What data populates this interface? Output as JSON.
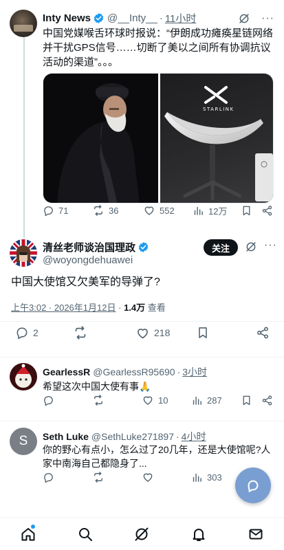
{
  "parent_tweet": {
    "author_name": "Inty News",
    "handle": "@__Inty__",
    "separator": "·",
    "time": "11小时",
    "text": "中国党媒喉舌环球时报说：“伊朗成功瘫痪星链网络并干扰GPS信号……切断了美以之间所有协调抗议活动的渠道”。。。",
    "image_right_logo_text": "STARLINK",
    "stats": {
      "replies": "71",
      "retweets": "36",
      "likes": "552",
      "views": "12万"
    }
  },
  "main_tweet": {
    "author_name": "清丝老师谈治国理政",
    "handle": "@woyongdehuawei",
    "follow_label": "关注",
    "text": "中国大使馆又欠美军的导弹了?",
    "timestamp": "上午3:02 · 2026年1月12日",
    "meta_separator": "·",
    "views_count": "1.4万",
    "views_label": "查看",
    "stats": {
      "replies": "2",
      "likes": "218"
    }
  },
  "replies": [
    {
      "author_name": "GearlessR",
      "handle": "@GearlessR95690",
      "separator": "·",
      "time": "3小时",
      "text": "希望这次中国大使有事🙏",
      "stats": {
        "likes": "10",
        "views": "287"
      }
    },
    {
      "author_name": "Seth Luke",
      "handle": "@SethLuke271897",
      "separator": "·",
      "time": "4小时",
      "avatar_letter": "S",
      "text": "你的野心有点小，怎么过了20几年，还是大使馆呢?人家中南海自己都隐身了...",
      "stats": {
        "views": "303"
      }
    }
  ],
  "more_glyph": "···",
  "colors": {
    "verified": "#1d9bf0",
    "text": "#0f1419",
    "muted": "#536471",
    "fab": "#6e96cd"
  },
  "icons": [
    "verified-badge-icon",
    "grok-icon",
    "reply-icon",
    "retweet-icon",
    "like-icon",
    "views-icon",
    "bookmark-icon",
    "share-icon",
    "home-icon",
    "search-icon",
    "bell-icon",
    "mail-icon",
    "compose-icon"
  ]
}
